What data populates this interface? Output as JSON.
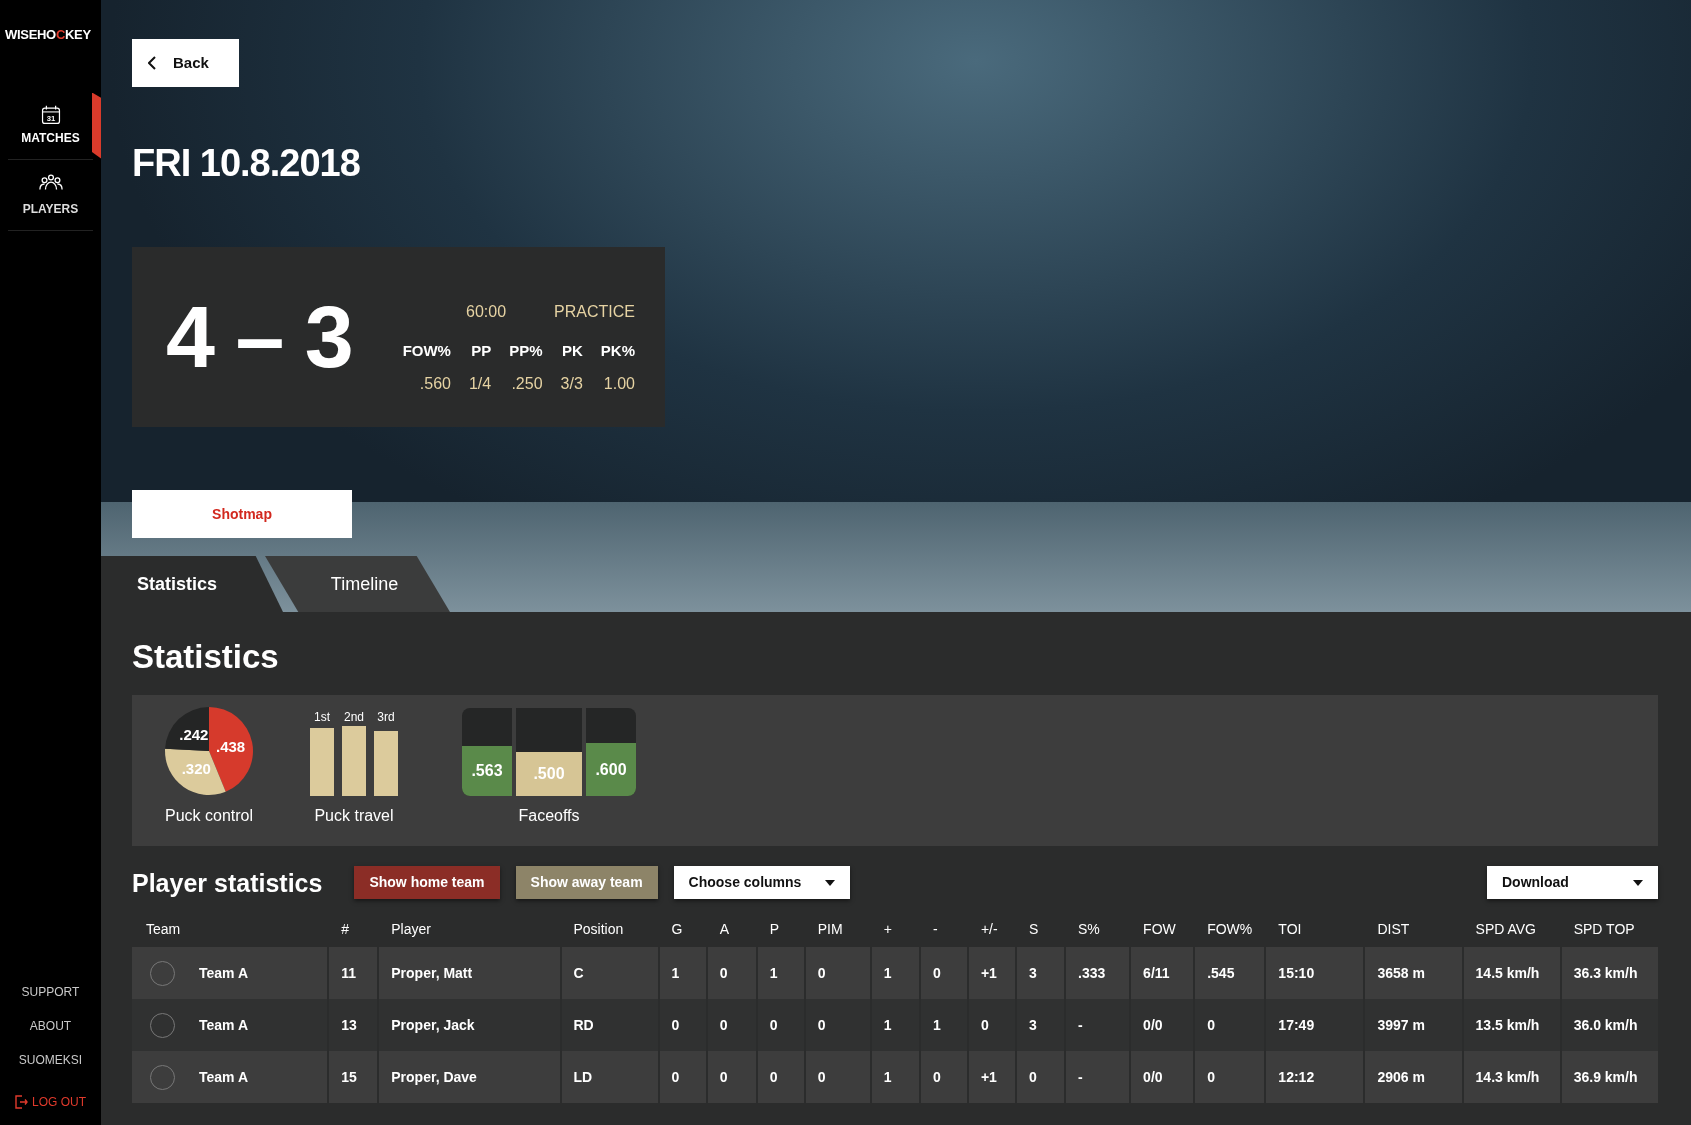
{
  "sidebar": {
    "logo": [
      {
        "text": "WISEHO",
        "accent": false
      },
      {
        "text": "C",
        "accent": true
      },
      {
        "text": "KEY",
        "accent": false
      }
    ],
    "nav": [
      {
        "kind": "calendar",
        "icon_label": "31",
        "label": "MATCHES",
        "selected": true
      },
      {
        "kind": "people",
        "label": "PLAYERS",
        "selected": false
      }
    ],
    "links": [
      {
        "kind": "plain",
        "label": "SUPPORT"
      },
      {
        "kind": "plain",
        "label": "ABOUT"
      },
      {
        "kind": "plain",
        "label": "SUOMEKSI"
      },
      {
        "kind": "logout",
        "label": "LOG OUT"
      }
    ]
  },
  "back_button": "Back",
  "title": "FRI 10.8.2018",
  "score": {
    "result": "4 – 3",
    "time": "60:00",
    "type": "PRACTICE",
    "stats": [
      {
        "label": "FOW%",
        "value": ".560"
      },
      {
        "label": "PP",
        "value": "1/4"
      },
      {
        "label": "PP%",
        "value": ".250"
      },
      {
        "label": "PK",
        "value": "3/3"
      },
      {
        "label": "PK%",
        "value": "1.00"
      }
    ]
  },
  "shotmap_button": "Shotmap",
  "tabs": [
    {
      "label": "Statistics",
      "selected": true
    },
    {
      "label": "Timeline",
      "selected": false
    }
  ],
  "heading": "Statistics",
  "summary": {
    "puck_control": {
      "caption": "Puck control",
      "chart_data": {
        "type": "pie",
        "values": [
          0.438,
          0.32,
          0.242
        ],
        "value_labels": [
          ".438",
          ".320",
          ".242"
        ],
        "colors": [
          "#d63a2c",
          "#dccb9c",
          "#242525"
        ]
      }
    },
    "puck_travel": {
      "caption": "Puck travel",
      "periods": [
        {
          "label": "1st"
        },
        {
          "label": "2nd"
        },
        {
          "label": "3rd"
        }
      ]
    },
    "faceoffs": {
      "caption": "Faceoffs",
      "periods": [
        {
          "reading": ".563",
          "level": 0.563,
          "color": "#5a8a4a"
        },
        {
          "reading": ".500",
          "level": 0.5,
          "color": "#d6c595"
        },
        {
          "reading": ".600",
          "level": 0.6,
          "color": "#5a8a4a"
        }
      ]
    }
  },
  "player_statistics": {
    "heading": "Player statistics",
    "buttons": [
      {
        "kind": "home",
        "label": "Show home team"
      },
      {
        "kind": "away",
        "label": "Show away team"
      },
      {
        "kind": "dropdown",
        "label": "Choose columns"
      }
    ],
    "download": "Download",
    "columns": [
      "Team",
      "#",
      "Player",
      "Position",
      "G",
      "A",
      "P",
      "PIM",
      "+",
      "-",
      "+/-",
      "S",
      "S%",
      "FOW",
      "FOW%",
      "TOI",
      "DIST",
      "SPD AVG",
      "SPD TOP"
    ],
    "rows": [
      [
        "Team A",
        "11",
        "Proper, Matt",
        "C",
        "1",
        "0",
        "1",
        "0",
        "1",
        "0",
        "+1",
        "3",
        ".333",
        "6/11",
        ".545",
        "15:10",
        "3658 m",
        "14.5 km/h",
        "36.3 km/h"
      ],
      [
        "Team A",
        "13",
        "Proper, Jack",
        "RD",
        "0",
        "0",
        "0",
        "0",
        "1",
        "1",
        "0",
        "3",
        "-",
        "0/0",
        "0",
        "17:49",
        "3997 m",
        "13.5 km/h",
        "36.0 km/h"
      ],
      [
        "Team A",
        "15",
        "Proper, Dave",
        "LD",
        "0",
        "0",
        "0",
        "0",
        "1",
        "0",
        "+1",
        "0",
        "-",
        "0/0",
        "0",
        "12:12",
        "2906 m",
        "14.3 km/h",
        "36.9 km/h"
      ]
    ]
  }
}
